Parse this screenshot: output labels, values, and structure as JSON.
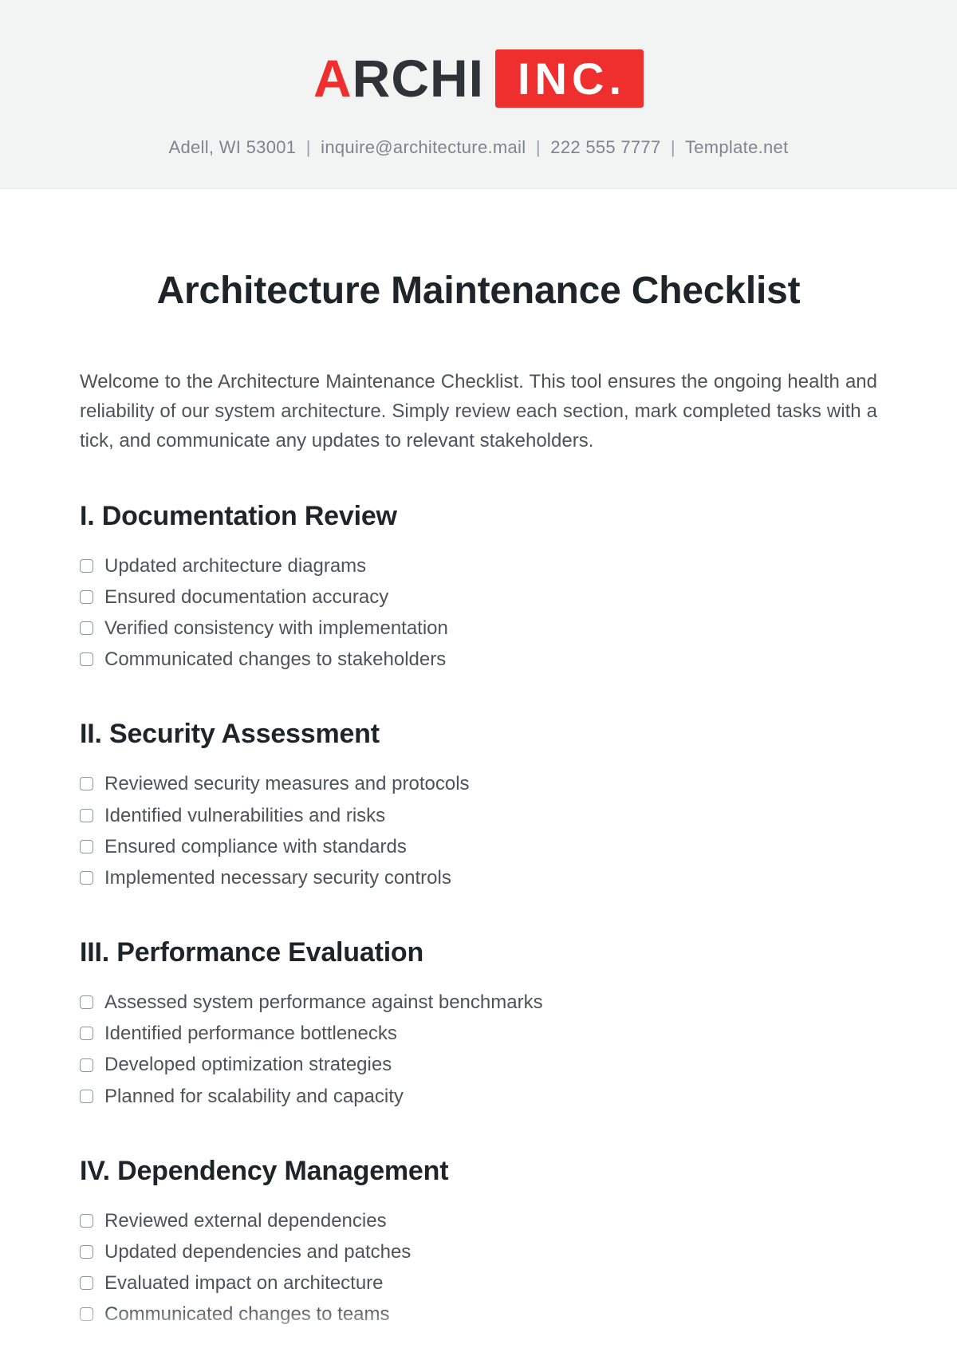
{
  "header": {
    "logo_archi_letter": "A",
    "logo_archi_rest": "RCHI",
    "logo_inc": "INC.",
    "contact": {
      "address": "Adell, WI 53001",
      "email": "inquire@architecture.mail",
      "phone": "222 555 7777",
      "site": "Template.net"
    }
  },
  "title": "Architecture Maintenance Checklist",
  "intro": "Welcome to the Architecture Maintenance Checklist. This tool ensures the ongoing health and reliability of our system architecture. Simply review each section, mark completed tasks with a tick, and communicate any updates to relevant stakeholders.",
  "sections": [
    {
      "heading": "I. Documentation Review",
      "items": [
        "Updated architecture diagrams",
        "Ensured documentation accuracy",
        "Verified consistency with implementation",
        "Communicated changes to stakeholders"
      ]
    },
    {
      "heading": "II. Security Assessment",
      "items": [
        "Reviewed security measures and protocols",
        "Identified vulnerabilities and risks",
        "Ensured compliance with standards",
        "Implemented necessary security controls"
      ]
    },
    {
      "heading": "III. Performance Evaluation",
      "items": [
        "Assessed system performance against benchmarks",
        "Identified performance bottlenecks",
        "Developed optimization strategies",
        "Planned for scalability and capacity"
      ]
    },
    {
      "heading": "IV. Dependency Management",
      "items": [
        "Reviewed external dependencies",
        "Updated dependencies and patches",
        "Evaluated impact on architecture",
        "Communicated changes to teams"
      ]
    }
  ]
}
